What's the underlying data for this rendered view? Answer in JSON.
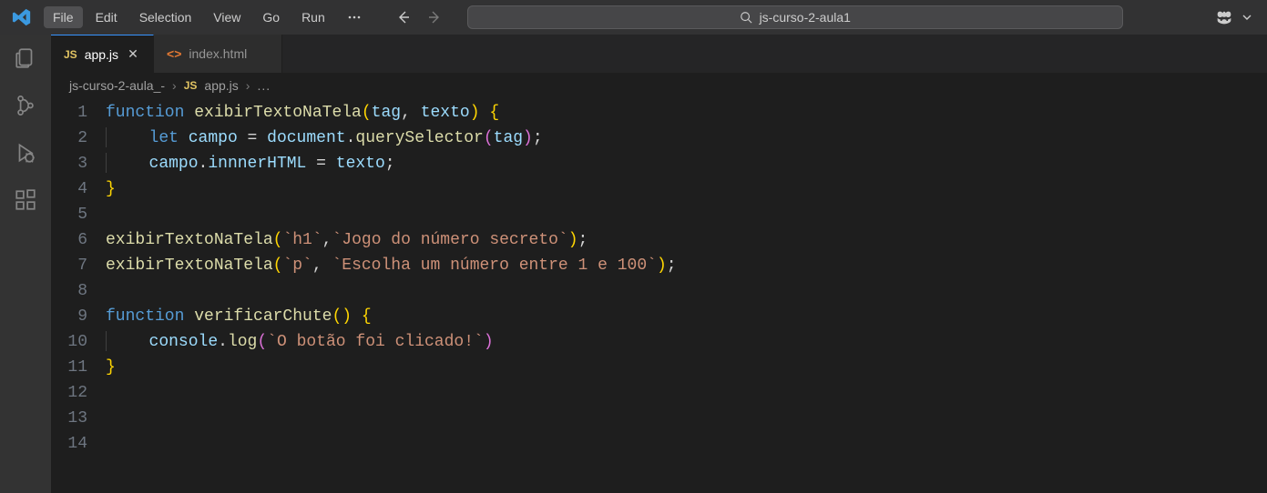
{
  "menu": {
    "file": "File",
    "edit": "Edit",
    "selection": "Selection",
    "view": "View",
    "go": "Go",
    "run": "Run"
  },
  "search": {
    "text": "js-curso-2-aula1"
  },
  "tabs": [
    {
      "label": "app.js",
      "badge": "JS",
      "active": true
    },
    {
      "label": "index.html",
      "badge": "<>",
      "active": false
    }
  ],
  "breadcrumbs": {
    "folder": "js-curso-2-aula_-",
    "file": "app.js",
    "filebadge": "JS",
    "more": "..."
  },
  "code": {
    "lines": [
      {
        "n": "1",
        "tokens": [
          [
            "kw",
            "function "
          ],
          [
            "fn",
            "exibirTextoNaTela"
          ],
          [
            "brace",
            "("
          ],
          [
            "var",
            "tag"
          ],
          [
            "pun",
            ", "
          ],
          [
            "var",
            "texto"
          ],
          [
            "brace",
            ")"
          ],
          [
            "pun",
            " "
          ],
          [
            "brace",
            "{"
          ]
        ]
      },
      {
        "n": "2",
        "indent": 1,
        "tokens": [
          [
            "kw",
            "let "
          ],
          [
            "var",
            "campo"
          ],
          [
            "pun",
            " = "
          ],
          [
            "var",
            "document"
          ],
          [
            "pun",
            "."
          ],
          [
            "fn",
            "querySelector"
          ],
          [
            "bracep",
            "("
          ],
          [
            "var",
            "tag"
          ],
          [
            "bracep",
            ")"
          ],
          [
            "pun",
            ";"
          ]
        ]
      },
      {
        "n": "3",
        "indent": 1,
        "tokens": [
          [
            "var",
            "campo"
          ],
          [
            "pun",
            "."
          ],
          [
            "var",
            "innnerHTML"
          ],
          [
            "pun",
            " = "
          ],
          [
            "var",
            "texto"
          ],
          [
            "pun",
            ";"
          ]
        ]
      },
      {
        "n": "4",
        "tokens": [
          [
            "brace",
            "}"
          ]
        ]
      },
      {
        "n": "5",
        "tokens": []
      },
      {
        "n": "6",
        "tokens": [
          [
            "fn",
            "exibirTextoNaTela"
          ],
          [
            "brace",
            "("
          ],
          [
            "str",
            "`h1`"
          ],
          [
            "pun",
            ","
          ],
          [
            "str",
            "`Jogo do número secreto`"
          ],
          [
            "brace",
            ")"
          ],
          [
            "pun",
            ";"
          ]
        ]
      },
      {
        "n": "7",
        "tokens": [
          [
            "fn",
            "exibirTextoNaTela"
          ],
          [
            "brace",
            "("
          ],
          [
            "str",
            "`p`"
          ],
          [
            "pun",
            ", "
          ],
          [
            "str",
            "`Escolha um número entre 1 e 100`"
          ],
          [
            "brace",
            ")"
          ],
          [
            "pun",
            ";"
          ]
        ]
      },
      {
        "n": "8",
        "tokens": []
      },
      {
        "n": "9",
        "tokens": [
          [
            "kw",
            "function "
          ],
          [
            "fn",
            "verificarChute"
          ],
          [
            "brace",
            "("
          ],
          [
            "brace",
            ")"
          ],
          [
            "pun",
            " "
          ],
          [
            "brace",
            "{"
          ]
        ]
      },
      {
        "n": "10",
        "indent": 1,
        "tokens": [
          [
            "var",
            "console"
          ],
          [
            "pun",
            "."
          ],
          [
            "fn",
            "log"
          ],
          [
            "bracep",
            "("
          ],
          [
            "str",
            "`O botão foi clicado!`"
          ],
          [
            "bracep",
            ")"
          ]
        ]
      },
      {
        "n": "11",
        "tokens": [
          [
            "brace",
            "}"
          ]
        ]
      },
      {
        "n": "12",
        "tokens": []
      },
      {
        "n": "13",
        "tokens": []
      },
      {
        "n": "14",
        "tokens": []
      }
    ]
  }
}
